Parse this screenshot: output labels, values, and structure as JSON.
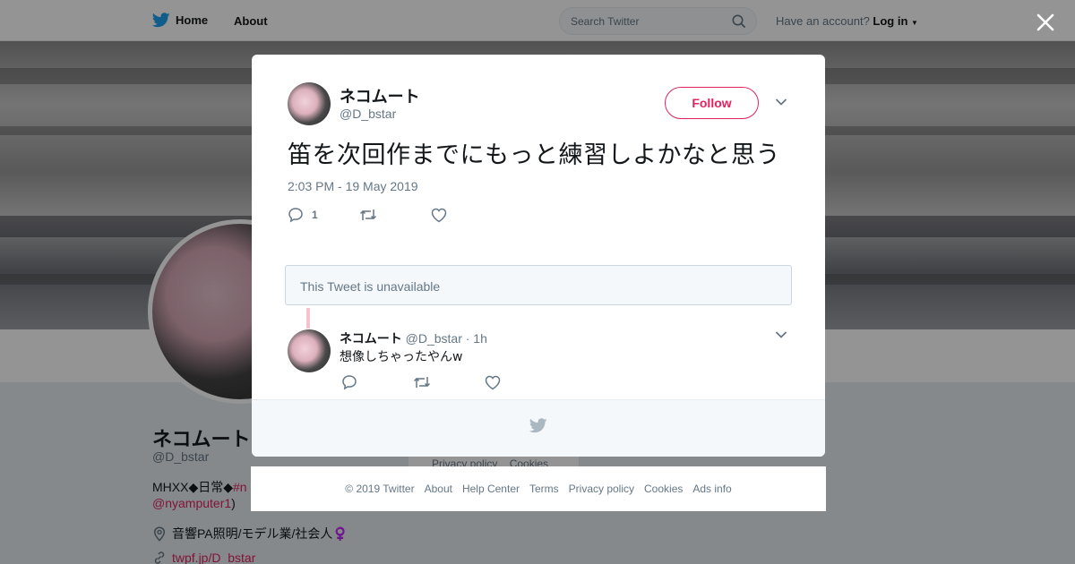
{
  "nav": {
    "home_label": "Home",
    "about_label": "About",
    "search_placeholder": "Search Twitter",
    "account_prompt": "Have an account?",
    "login_label": "Log in"
  },
  "profile": {
    "name": "ネコムート",
    "handle": "@D_bstar",
    "bio_prefix": "MHXX◆日常◆",
    "bio_hashtag": "#n",
    "bio_mention": "@nyamputer1",
    "bio_suffix": ")",
    "location": "音響PA照明/モデル業/社会人♀️",
    "url": "twpf.jp/D_bstar",
    "privacy_label": "Privacy policy",
    "cookies_label": "Cookies"
  },
  "tweet": {
    "author_name": "ネコムート",
    "author_handle": "@D_bstar",
    "follow_label": "Follow",
    "text": "笛を次回作までにもっと練習しよかなと思う",
    "timestamp": "2:03 PM - 19 May 2019",
    "reply_count": "1"
  },
  "unavailable_notice": "This Tweet is unavailable",
  "reply": {
    "author_name": "ネコムート",
    "author_handle": "@D_bstar",
    "time": "· 1h",
    "text": "想像しちゃったやんw"
  },
  "footer": {
    "copyright": "© 2019 Twitter",
    "about": "About",
    "help": "Help Center",
    "terms": "Terms",
    "privacy": "Privacy policy",
    "cookies": "Cookies",
    "ads": "Ads info"
  },
  "colors": {
    "accent": "#e0245e",
    "twitter_blue": "#1da1f2",
    "muted": "#657786"
  }
}
